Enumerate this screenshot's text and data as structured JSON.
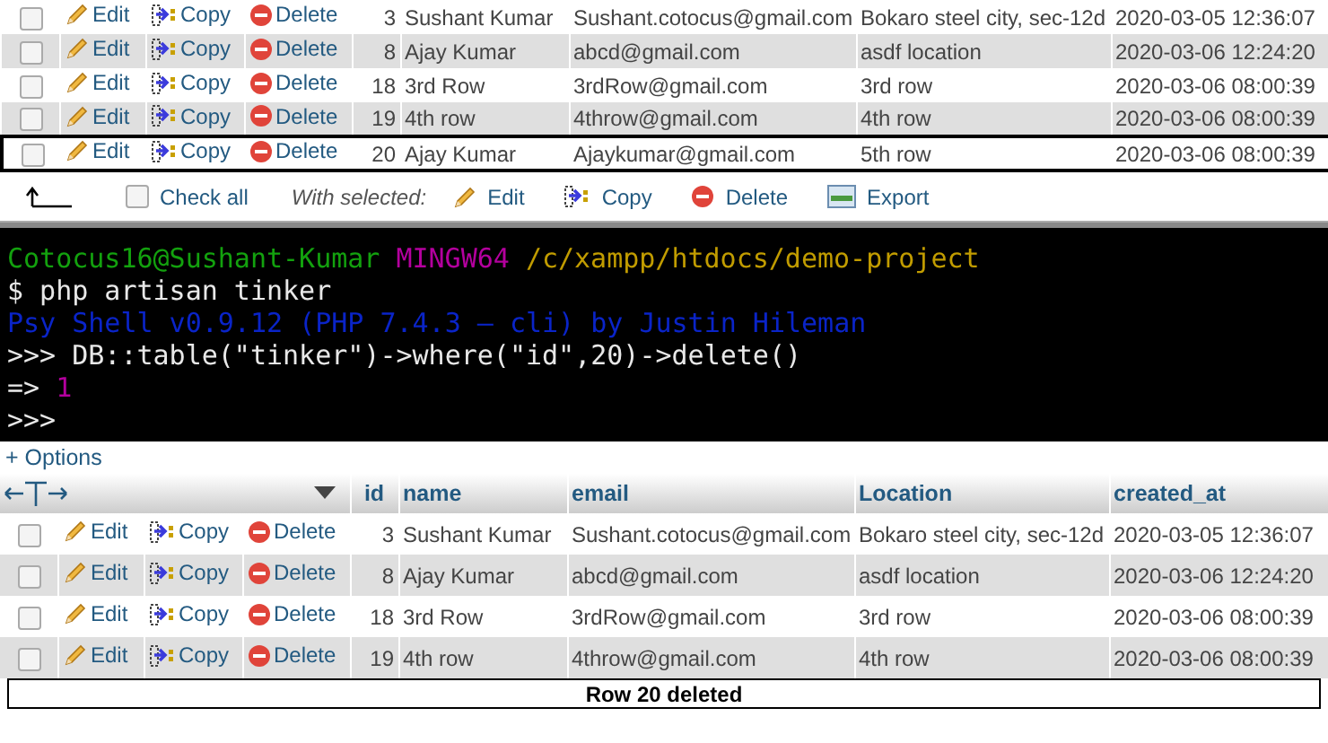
{
  "top_table": {
    "rows": [
      {
        "checked": false,
        "marked": false,
        "edit": "Edit",
        "copy": "Copy",
        "delete": "Delete",
        "id": "3",
        "name": "Sushant Kumar",
        "email": "Sushant.cotocus@gmail.com",
        "location": "Bokaro steel city, sec-12d",
        "created_at": "2020-03-05 12:36:07"
      },
      {
        "checked": false,
        "marked": false,
        "edit": "Edit",
        "copy": "Copy",
        "delete": "Delete",
        "id": "8",
        "name": "Ajay Kumar",
        "email": "abcd@gmail.com",
        "location": "asdf location",
        "created_at": "2020-03-06 12:24:20"
      },
      {
        "checked": false,
        "marked": false,
        "edit": "Edit",
        "copy": "Copy",
        "delete": "Delete",
        "id": "18",
        "name": "3rd Row",
        "email": "3rdRow@gmail.com",
        "location": "3rd row",
        "created_at": "2020-03-06 08:00:39"
      },
      {
        "checked": false,
        "marked": false,
        "edit": "Edit",
        "copy": "Copy",
        "delete": "Delete",
        "id": "19",
        "name": "4th row",
        "email": "4throw@gmail.com",
        "location": "4th row",
        "created_at": "2020-03-06 08:00:39"
      },
      {
        "checked": false,
        "marked": true,
        "edit": "Edit",
        "copy": "Copy",
        "delete": "Delete",
        "id": "20",
        "name": "Ajay Kumar",
        "email": "Ajaykumar@gmail.com",
        "location": "5th row",
        "created_at": "2020-03-06 08:00:39"
      }
    ]
  },
  "bulk_bar": {
    "check_all": {
      "label": "Check all",
      "checked": false
    },
    "with_selected": "With selected:",
    "actions": [
      {
        "kind": "edit",
        "label": "Edit"
      },
      {
        "kind": "copy",
        "label": "Copy"
      },
      {
        "kind": "delete",
        "label": "Delete"
      },
      {
        "kind": "export",
        "label": "Export"
      }
    ]
  },
  "terminal": {
    "lines": [
      [
        {
          "text": "Cotocus16@Sushant-Kumar",
          "color": "#13a10e"
        },
        {
          "text": "MINGW64",
          "color": "#b4009e"
        },
        {
          "text": "/c/xampp/htdocs/demo-project",
          "color": "#c19c00"
        }
      ],
      [
        {
          "text": "$ php artisan tinker",
          "color": "#e8e8e8"
        }
      ],
      [
        {
          "text": "Psy Shell v0.9.12 (PHP 7.4.3 — cli) by Justin Hileman",
          "color": "#0a24c8"
        }
      ],
      [
        {
          "text": ">>> DB::table(\"tinker\")->where(\"id\",20)->delete()",
          "color": "#e8e8e8"
        }
      ],
      [
        {
          "text": "=>",
          "color": "#e8e8e8"
        },
        {
          "text": "1",
          "color": "#b4009e"
        }
      ],
      [
        {
          "text": ">>>",
          "color": "#e8e8e8"
        }
      ]
    ]
  },
  "options_link": "+ Options",
  "bottom_table": {
    "columns": [
      "id",
      "name",
      "email",
      "Location",
      "created_at"
    ],
    "rows": [
      {
        "checked": false,
        "edit": "Edit",
        "copy": "Copy",
        "delete": "Delete",
        "id": "3",
        "name": "Sushant Kumar",
        "email": "Sushant.cotocus@gmail.com",
        "location": "Bokaro steel city, sec-12d",
        "created_at": "2020-03-05 12:36:07"
      },
      {
        "checked": false,
        "edit": "Edit",
        "copy": "Copy",
        "delete": "Delete",
        "id": "8",
        "name": "Ajay Kumar",
        "email": "abcd@gmail.com",
        "location": "asdf location",
        "created_at": "2020-03-06 12:24:20"
      },
      {
        "checked": false,
        "edit": "Edit",
        "copy": "Copy",
        "delete": "Delete",
        "id": "18",
        "name": "3rd Row",
        "email": "3rdRow@gmail.com",
        "location": "3rd row",
        "created_at": "2020-03-06 08:00:39"
      },
      {
        "checked": false,
        "edit": "Edit",
        "copy": "Copy",
        "delete": "Delete",
        "id": "19",
        "name": "4th row",
        "email": "4throw@gmail.com",
        "location": "4th row",
        "created_at": "2020-03-06 08:00:39"
      }
    ]
  },
  "caption": "Row 20 deleted"
}
